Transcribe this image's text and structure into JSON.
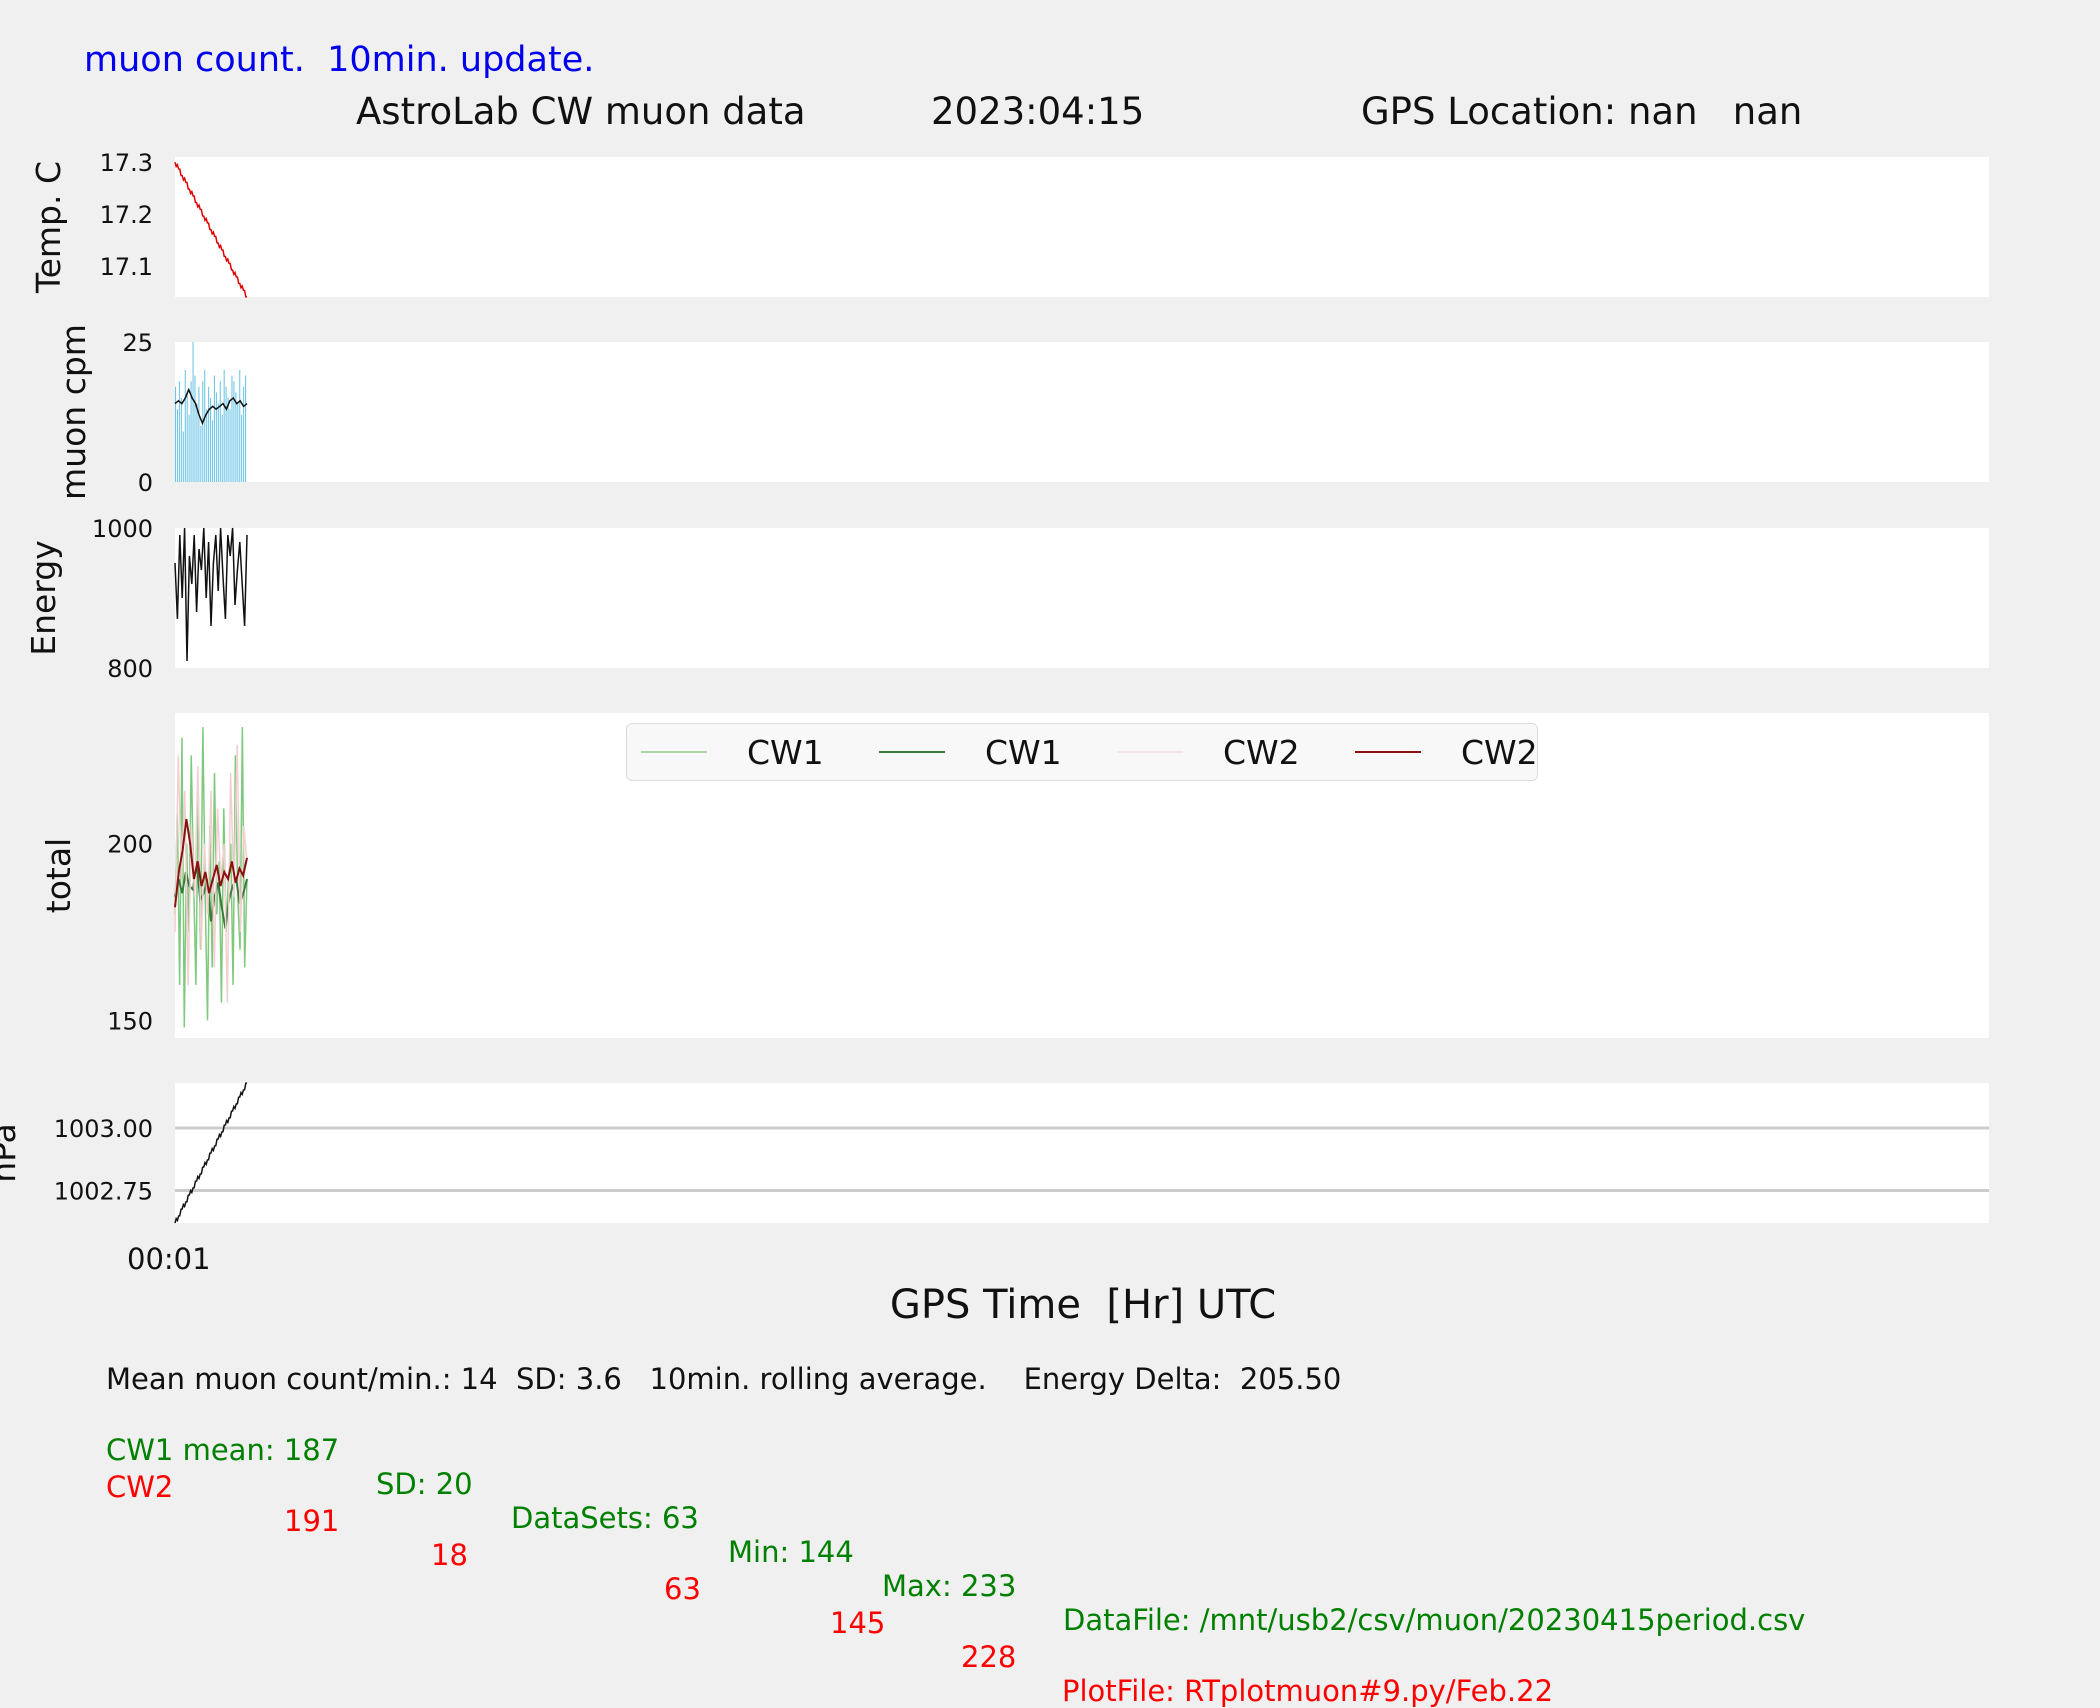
{
  "header": {
    "note": "muon count.  10min. update.",
    "title": "AstroLab CW muon data",
    "date": "2023:04:15",
    "gps": "GPS Location: nan   nan"
  },
  "chart_data": [
    {
      "type": "line",
      "ylabel": "Temp. C",
      "yticks": [
        "17.3",
        "17.2",
        "17.1"
      ],
      "ylim": [
        17.04,
        17.31
      ],
      "series": [
        {
          "color": "#e00000",
          "x": [
            0,
            0.71
          ],
          "y": [
            17.3,
            17.04
          ]
        }
      ]
    },
    {
      "type": "bar",
      "ylabel": "muon cpm",
      "yticks": [
        "25",
        "0"
      ],
      "ylim": [
        0,
        25
      ],
      "values": [
        17,
        13,
        18,
        15,
        9,
        20,
        16,
        12,
        18,
        25,
        19,
        14,
        17,
        10,
        18,
        20,
        13,
        17,
        15,
        11,
        19,
        16,
        14,
        18,
        12,
        20,
        17,
        15,
        13,
        19,
        18,
        16,
        14,
        20,
        12,
        17,
        19
      ],
      "rolling": [
        14,
        14.5,
        14,
        15,
        16.5,
        15,
        14,
        12,
        10.5,
        12,
        13,
        13.5,
        13,
        13.5,
        14,
        13,
        14.5,
        15,
        14,
        14.5,
        13.5,
        14
      ],
      "bar_color": "#6ec6e6",
      "rolling_color": "#111111"
    },
    {
      "type": "line",
      "ylabel": "Energy",
      "yticks": [
        "1000",
        "800"
      ],
      "ylim": [
        800,
        1000
      ],
      "series": [
        {
          "color": "#111111",
          "y": [
            950,
            870,
            990,
            900,
            1000,
            810,
            960,
            920,
            990,
            880,
            970,
            940,
            1000,
            900,
            980,
            860,
            950,
            990,
            910,
            1000,
            930,
            870,
            990,
            960,
            1000,
            890,
            940,
            980,
            920,
            860,
            990
          ]
        }
      ]
    },
    {
      "type": "line",
      "ylabel": "total",
      "yticks": [
        "200",
        "150"
      ],
      "ylim": [
        145,
        237
      ],
      "legend": [
        {
          "label": "CW1",
          "color": "#a8d8a8"
        },
        {
          "label": "CW1",
          "color": "#3c7a3c"
        },
        {
          "label": "CW2",
          "color": "#f7e6e6"
        },
        {
          "label": "CW2",
          "color": "#8b1010"
        }
      ],
      "series": [
        {
          "name": "CW1",
          "color": "#7fc97f",
          "y": [
            180,
            210,
            160,
            230,
            148,
            200,
            175,
            225,
            190,
            160,
            215,
            170,
            233,
            185,
            150,
            205,
            165,
            220,
            180,
            195,
            155,
            210,
            175,
            190,
            200,
            160,
            225,
            185,
            170,
            233,
            165,
            190
          ]
        },
        {
          "name": "CW1",
          "color": "#3c7a3c",
          "y": [
            185,
            190,
            186,
            192,
            188,
            187,
            195,
            184,
            186,
            190,
            178,
            185,
            189,
            182,
            176,
            184,
            188,
            190,
            183,
            186,
            190
          ]
        },
        {
          "name": "CW2",
          "color": "#f2d0d0",
          "y": [
            175,
            225,
            190,
            215,
            160,
            205,
            185,
            222,
            170,
            200,
            180,
            215,
            165,
            210,
            190,
            200,
            155,
            220,
            185,
            228,
            175,
            205,
            195
          ]
        },
        {
          "name": "CW2",
          "color": "#8b1010",
          "y": [
            182,
            192,
            198,
            207,
            200,
            190,
            195,
            188,
            192,
            186,
            190,
            194,
            188,
            192,
            190,
            195,
            189,
            193,
            191,
            196
          ]
        }
      ]
    },
    {
      "type": "line",
      "ylabel": "hPa",
      "yticks": [
        "1003.00",
        "1002.75"
      ],
      "yticks_values": [
        1003.0,
        1002.75
      ],
      "ylim": [
        1002.62,
        1003.18
      ],
      "grid": true,
      "series": [
        {
          "color": "#111111",
          "x": [
            0,
            0.71
          ],
          "y": [
            1002.62,
            1003.18
          ]
        }
      ]
    }
  ],
  "xaxis": {
    "tick": "00:01",
    "label": "GPS Time  [Hr] UTC"
  },
  "stats": {
    "line1": "Mean muon count/min.: 14  SD: 3.6   10min. rolling average.    Energy Delta:  205.50",
    "cw1": {
      "label": "CW1 mean: 187",
      "sd": "SD: 20",
      "datasets": "DataSets: 63",
      "min": "Min: 144",
      "max": "Max: 233",
      "file": "DataFile: /mnt/usb2/csv/muon/20230415period.csv"
    },
    "cw2": {
      "label": "CW2",
      "mean": "191",
      "sd": "18",
      "datasets": "63",
      "min": "145",
      "max": "228",
      "file": "PlotFile: RTplotmuon#9.py/Feb.22"
    }
  }
}
